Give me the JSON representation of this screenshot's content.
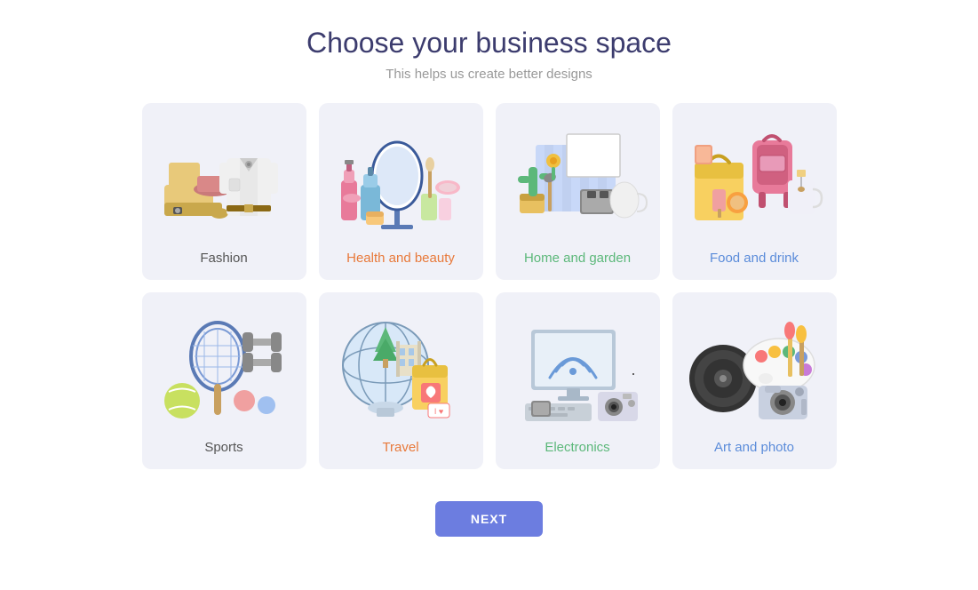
{
  "header": {
    "title": "Choose your business space",
    "subtitle": "This helps us create better designs"
  },
  "cards": [
    {
      "id": "fashion",
      "label": "Fashion",
      "label_color": "label-gray"
    },
    {
      "id": "health-beauty",
      "label": "Health and beauty",
      "label_color": "label-orange"
    },
    {
      "id": "home-garden",
      "label": "Home and garden",
      "label_color": "label-green"
    },
    {
      "id": "food-drink",
      "label": "Food and drink",
      "label_color": "label-blue"
    },
    {
      "id": "sports",
      "label": "Sports",
      "label_color": "label-gray"
    },
    {
      "id": "travel",
      "label": "Travel",
      "label_color": "label-orange"
    },
    {
      "id": "electronics",
      "label": "Electronics",
      "label_color": "label-green"
    },
    {
      "id": "art-photo",
      "label": "Art and photo",
      "label_color": "label-blue"
    }
  ],
  "next_button": "NEXT"
}
